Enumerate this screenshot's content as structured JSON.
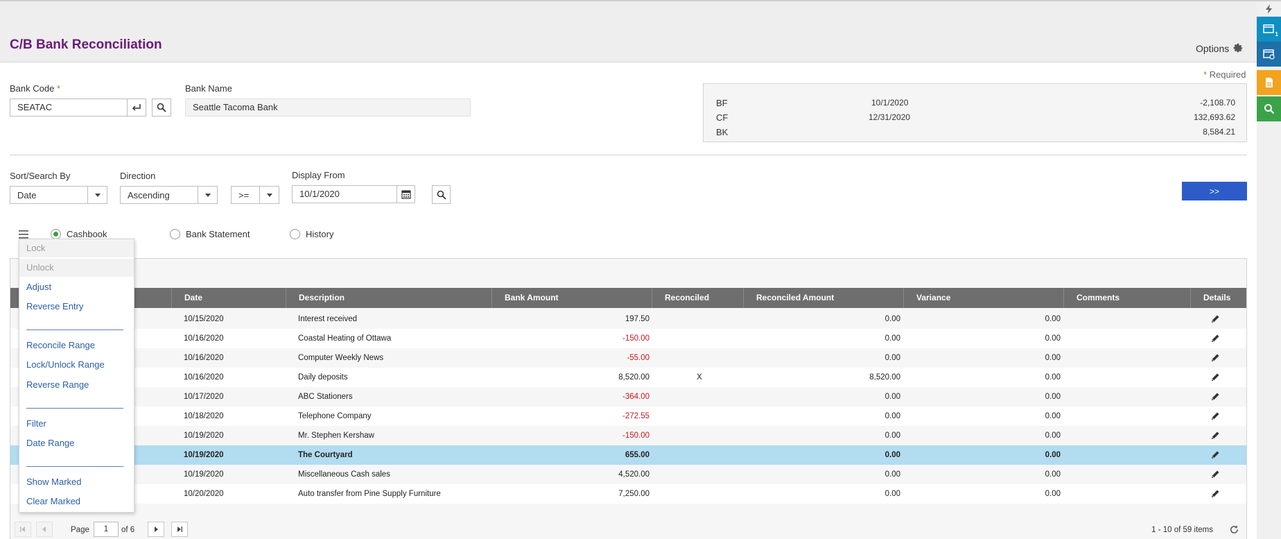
{
  "header": {
    "title": "C/B Bank Reconciliation",
    "options_label": "Options"
  },
  "right_rail": {
    "icons": [
      "lightning-icon",
      "window-badge-icon",
      "window-settings-icon",
      "document-icon",
      "search-icon"
    ],
    "badge": "1",
    "colors": [
      "#0f8fc2",
      "#1f6fa8",
      "#f2a41e",
      "#3aa34a"
    ]
  },
  "bank": {
    "code_label": "Bank Code",
    "required_mark": "*",
    "code_value": "SEATAC",
    "name_label": "Bank Name",
    "name_value": "Seattle Tacoma Bank"
  },
  "required_note": "Required",
  "summary": [
    {
      "code": "BF",
      "date": "10/1/2020",
      "amount": "-2,108.70"
    },
    {
      "code": "CF",
      "date": "12/31/2020",
      "amount": "132,693.62"
    },
    {
      "code": "BK",
      "date": "",
      "amount": "8,584.21"
    }
  ],
  "filters": {
    "sort_label": "Sort/Search By",
    "sort_value": "Date",
    "direction_label": "Direction",
    "direction_value": "Ascending",
    "operator_value": ">=",
    "display_from_label": "Display From",
    "display_from_value": "10/1/2020",
    "go_label": ">>"
  },
  "views": {
    "cashbook": "Cashbook",
    "bank_statement": "Bank Statement",
    "history": "History",
    "selected": "cashbook"
  },
  "menu": {
    "items": [
      {
        "label": "Lock",
        "enabled": false
      },
      {
        "label": "Unlock",
        "enabled": false
      },
      {
        "label": "Adjust",
        "enabled": true
      },
      {
        "label": "Reverse Entry",
        "enabled": true
      },
      {
        "label": "Reconcile Range",
        "enabled": true
      },
      {
        "label": "Lock/Unlock Range",
        "enabled": true
      },
      {
        "label": "Reverse Range",
        "enabled": true
      },
      {
        "label": "Filter",
        "enabled": true
      },
      {
        "label": "Date Range",
        "enabled": true
      },
      {
        "label": "Show Marked",
        "enabled": true
      },
      {
        "label": "Clear Marked",
        "enabled": true
      }
    ]
  },
  "grid": {
    "columns": [
      "Date",
      "Description",
      "Bank Amount",
      "Reconciled",
      "Reconciled Amount",
      "Variance",
      "Comments",
      "Details"
    ],
    "rows": [
      {
        "date": "10/15/2020",
        "description": "Interest received",
        "bank_amount": "197.50",
        "reconciled": "",
        "reconciled_amount": "0.00",
        "variance": "0.00",
        "comments": ""
      },
      {
        "date": "10/16/2020",
        "description": "Coastal Heating of Ottawa",
        "bank_amount": "-150.00",
        "reconciled": "",
        "reconciled_amount": "0.00",
        "variance": "0.00",
        "comments": ""
      },
      {
        "date": "10/16/2020",
        "description": "Computer Weekly News",
        "bank_amount": "-55.00",
        "reconciled": "",
        "reconciled_amount": "0.00",
        "variance": "0.00",
        "comments": ""
      },
      {
        "date": "10/16/2020",
        "description": "Daily deposits",
        "bank_amount": "8,520.00",
        "reconciled": "X",
        "reconciled_amount": "8,520.00",
        "variance": "0.00",
        "comments": ""
      },
      {
        "date": "10/17/2020",
        "description": "ABC Stationers",
        "bank_amount": "-364.00",
        "reconciled": "",
        "reconciled_amount": "0.00",
        "variance": "0.00",
        "comments": ""
      },
      {
        "date": "10/18/2020",
        "description": "Telephone Company",
        "bank_amount": "-272.55",
        "reconciled": "",
        "reconciled_amount": "0.00",
        "variance": "0.00",
        "comments": ""
      },
      {
        "date": "10/19/2020",
        "description": "Mr. Stephen Kershaw",
        "bank_amount": "-150.00",
        "reconciled": "",
        "reconciled_amount": "0.00",
        "variance": "0.00",
        "comments": ""
      },
      {
        "date": "10/19/2020",
        "description": "The Courtyard",
        "bank_amount": "655.00",
        "reconciled": "",
        "reconciled_amount": "0.00",
        "variance": "0.00",
        "comments": "",
        "selected": true
      },
      {
        "date": "10/19/2020",
        "description": "Miscellaneous Cash sales",
        "bank_amount": "4,520.00",
        "reconciled": "",
        "reconciled_amount": "0.00",
        "variance": "0.00",
        "comments": ""
      },
      {
        "date": "10/20/2020",
        "description": "Auto transfer from Pine Supply Furniture",
        "bank_amount": "7,250.00",
        "reconciled": "",
        "reconciled_amount": "0.00",
        "variance": "0.00",
        "comments": ""
      }
    ]
  },
  "pager": {
    "page_label": "Page",
    "page_value": "1",
    "of_label": "of 6",
    "items_summary": "1 - 10 of 59 items"
  }
}
